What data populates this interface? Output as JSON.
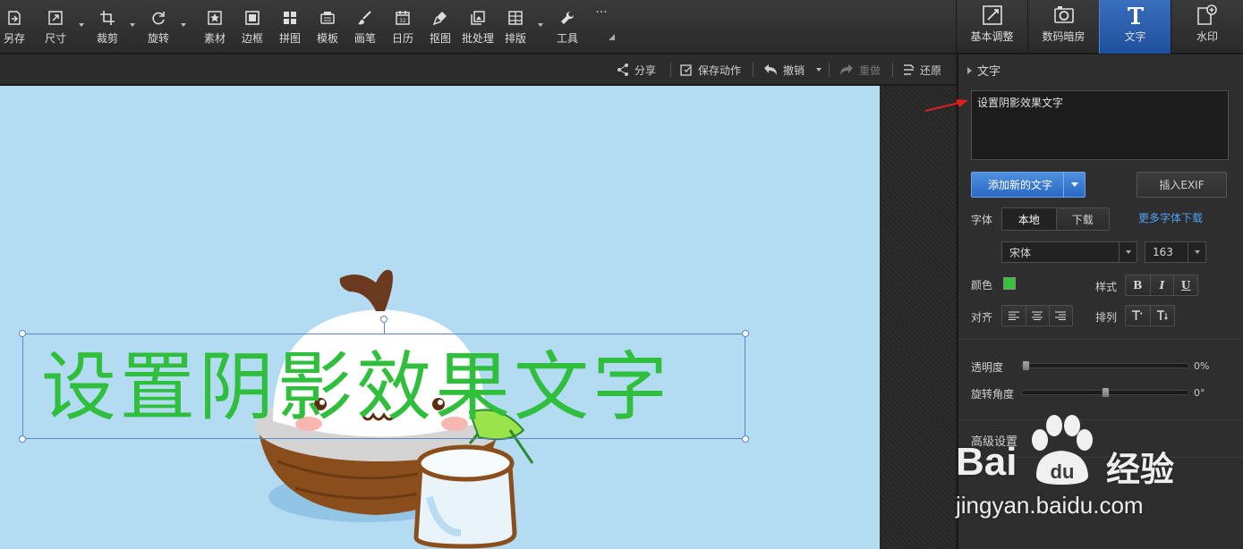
{
  "toolbar": {
    "items": [
      {
        "label": "另存",
        "icon": "save-as-icon"
      },
      {
        "label": "尺寸",
        "icon": "resize-icon"
      },
      {
        "label": "裁剪",
        "icon": "crop-icon"
      },
      {
        "label": "旋转",
        "icon": "rotate-icon"
      },
      {
        "label": "素材",
        "icon": "material-icon"
      },
      {
        "label": "边框",
        "icon": "border-icon"
      },
      {
        "label": "拼图",
        "icon": "collage-icon"
      },
      {
        "label": "模板",
        "icon": "template-icon"
      },
      {
        "label": "画笔",
        "icon": "brush-icon"
      },
      {
        "label": "日历",
        "icon": "calendar-icon"
      },
      {
        "label": "抠图",
        "icon": "cutout-icon"
      },
      {
        "label": "批处理",
        "icon": "batch-icon"
      },
      {
        "label": "排版",
        "icon": "layout-icon"
      },
      {
        "label": "工具",
        "icon": "wrench-icon"
      }
    ],
    "more_glyph": "···",
    "calendar_number": "32"
  },
  "right_tabs": [
    {
      "label": "基本调整",
      "icon": "basic-adjust-icon",
      "active": false
    },
    {
      "label": "数码暗房",
      "icon": "darkroom-icon",
      "active": false
    },
    {
      "label": "文字",
      "icon": "text-icon",
      "active": true
    },
    {
      "label": "水印",
      "icon": "watermark-icon",
      "active": false
    }
  ],
  "subbar": {
    "share": "分享",
    "save_action": "保存动作",
    "undo": "撤销",
    "redo": "重做",
    "restore": "还原"
  },
  "canvas": {
    "background_color": "#b3dbf2",
    "overlay_text": "设置阴影效果文字",
    "overlay_text_color": "#2fbf3c"
  },
  "panel": {
    "section_title": "文字",
    "text_value": "设置阴影效果文字",
    "add_text_button": "添加新的文字",
    "insert_exif_button": "插入EXIF",
    "font_label": "字体",
    "font_source_tabs": [
      "本地",
      "下载"
    ],
    "more_fonts_link": "更多字体下载",
    "font_family": "宋体",
    "font_size": "163",
    "color_label": "颜色",
    "color_value": "#35c43c",
    "style_label": "样式",
    "style_buttons": [
      "B",
      "I",
      "U"
    ],
    "align_label": "对齐",
    "arrange_label": "排列",
    "opacity_label": "透明度",
    "opacity_value": "0%",
    "opacity_fraction": 0,
    "rotation_label": "旋转角度",
    "rotation_value": "0°",
    "rotation_fraction": 0.5,
    "advanced_label": "高级设置"
  },
  "watermark": {
    "brand_left": "Bai",
    "brand_right": "经验",
    "url": "jingyan.baidu.com"
  }
}
